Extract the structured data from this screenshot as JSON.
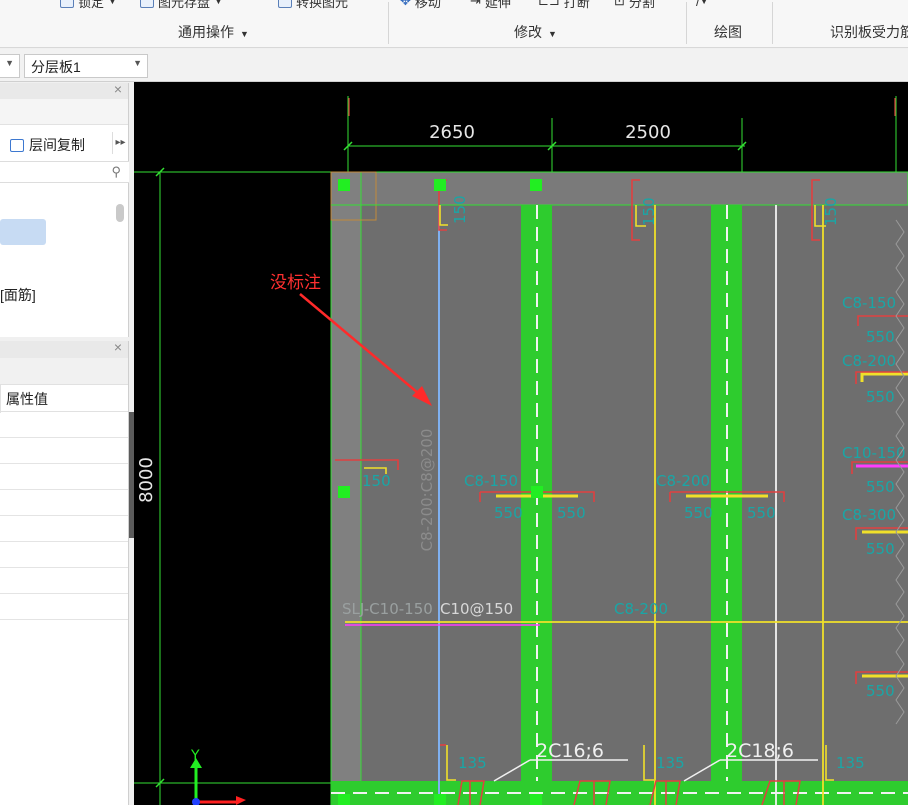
{
  "ribbon": {
    "tools": {
      "lock": "锁定",
      "block_save": "图元存盘",
      "convert_block": "转换图元",
      "move": "移动",
      "extend": "延伸",
      "break": "打断",
      "split": "分割"
    },
    "groups": {
      "general": "通用操作",
      "modify": "修改",
      "draw": "绘图",
      "identify": "识别板受力筋"
    }
  },
  "toolbar": {
    "layer_value": "分层板1"
  },
  "left_panel": {
    "floor_copy": "层间复制",
    "tree_item_selected": "",
    "tree_item_label": "[面筋]",
    "property_header": "属性值"
  },
  "drawing": {
    "dim_top_1": "2650",
    "dim_top_2": "2500",
    "dim_left": "8000",
    "annotation_note": "没标注",
    "rebar_vertical": "C8-200:C8@200",
    "rebar_horizontal": "SLJ-C10-150",
    "rebar_horizontal_2": "C10@150",
    "rebar_mid_label": "C8-200",
    "label_150": "150",
    "label_550": "550",
    "label_c8150": "C8-150",
    "label_c8200": "C8-200",
    "label_c10150": "C10-150",
    "label_c8300": "C8-300",
    "bottom_1": "2C16;6",
    "bottom_2": "2C18;6",
    "label_135": "135",
    "axis_y": "Y"
  },
  "colors": {
    "canvas_bg": "#000000",
    "slab": "#6e6e6e",
    "grid_green": "#33e033",
    "rebar_yellow": "#f0e02a",
    "rebar_red": "#e04040",
    "rebar_teal": "#19a6a6",
    "rebar_blue": "#7fb0f0",
    "magenta": "#ff3cff",
    "note_red": "#ff3030"
  }
}
